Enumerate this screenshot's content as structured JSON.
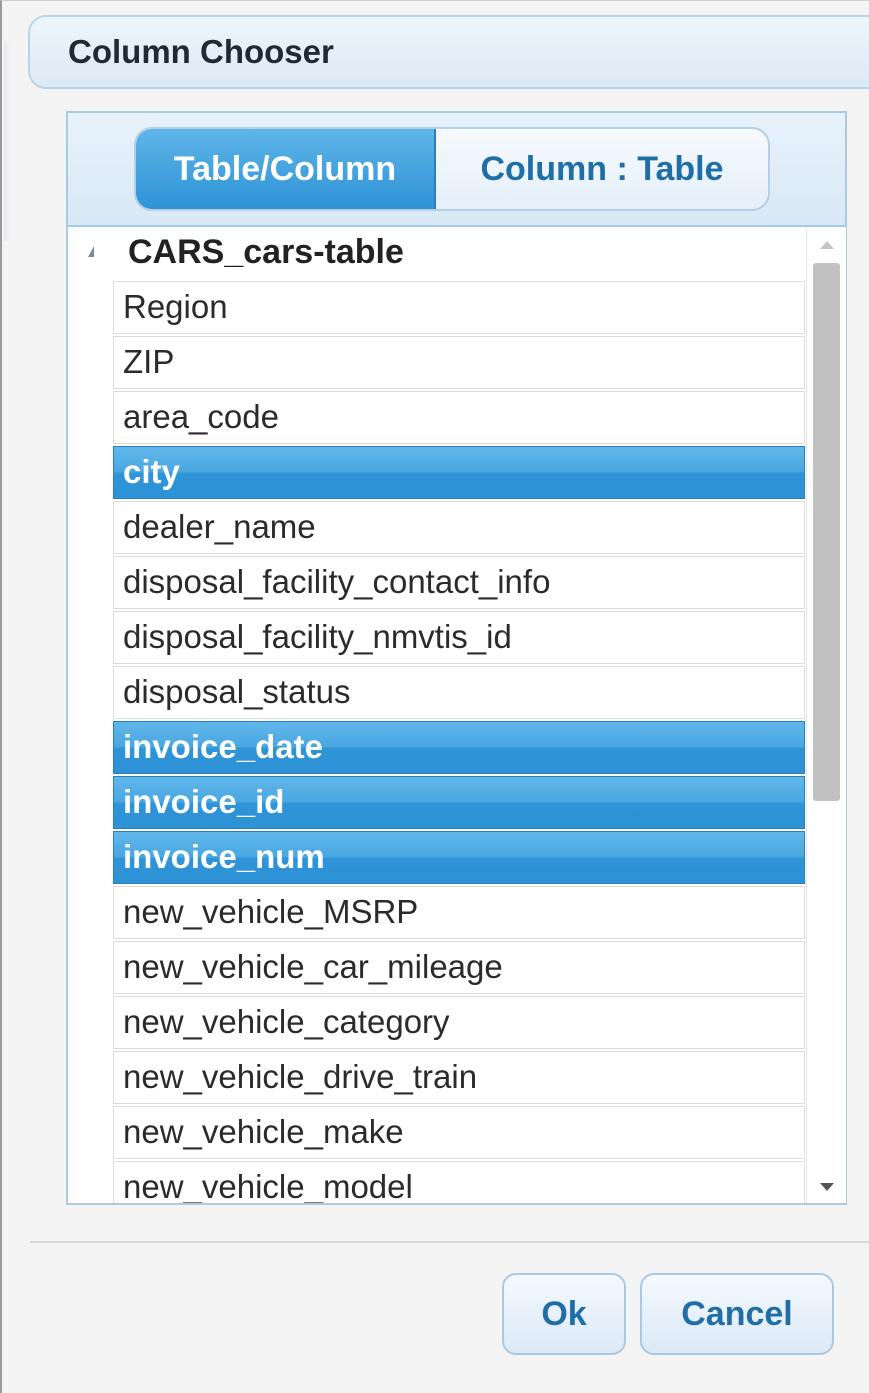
{
  "dialog": {
    "title": "Column Chooser"
  },
  "view_toggle": {
    "options": [
      "Table/Column",
      "Column : Table"
    ],
    "selected": "Table/Column"
  },
  "tree": {
    "root": {
      "label": "CARS_cars-table",
      "expanded": true
    },
    "items": [
      {
        "label": "Region",
        "selected": false
      },
      {
        "label": "ZIP",
        "selected": false
      },
      {
        "label": "area_code",
        "selected": false
      },
      {
        "label": "city",
        "selected": true
      },
      {
        "label": "dealer_name",
        "selected": false
      },
      {
        "label": "disposal_facility_contact_info",
        "selected": false
      },
      {
        "label": "disposal_facility_nmvtis_id",
        "selected": false
      },
      {
        "label": "disposal_status",
        "selected": false
      },
      {
        "label": "invoice_date",
        "selected": true
      },
      {
        "label": "invoice_id",
        "selected": true
      },
      {
        "label": "invoice_num",
        "selected": true
      },
      {
        "label": "new_vehicle_MSRP",
        "selected": false
      },
      {
        "label": "new_vehicle_car_mileage",
        "selected": false
      },
      {
        "label": "new_vehicle_category",
        "selected": false
      },
      {
        "label": "new_vehicle_drive_train",
        "selected": false
      },
      {
        "label": "new_vehicle_make",
        "selected": false
      },
      {
        "label": "new_vehicle_model",
        "selected": false
      }
    ]
  },
  "buttons": {
    "ok_label": "Ok",
    "cancel_label": "Cancel"
  },
  "colors": {
    "accent": "#2e93d6",
    "button_text": "#1f6fa6",
    "selected_text": "#ffffff"
  }
}
